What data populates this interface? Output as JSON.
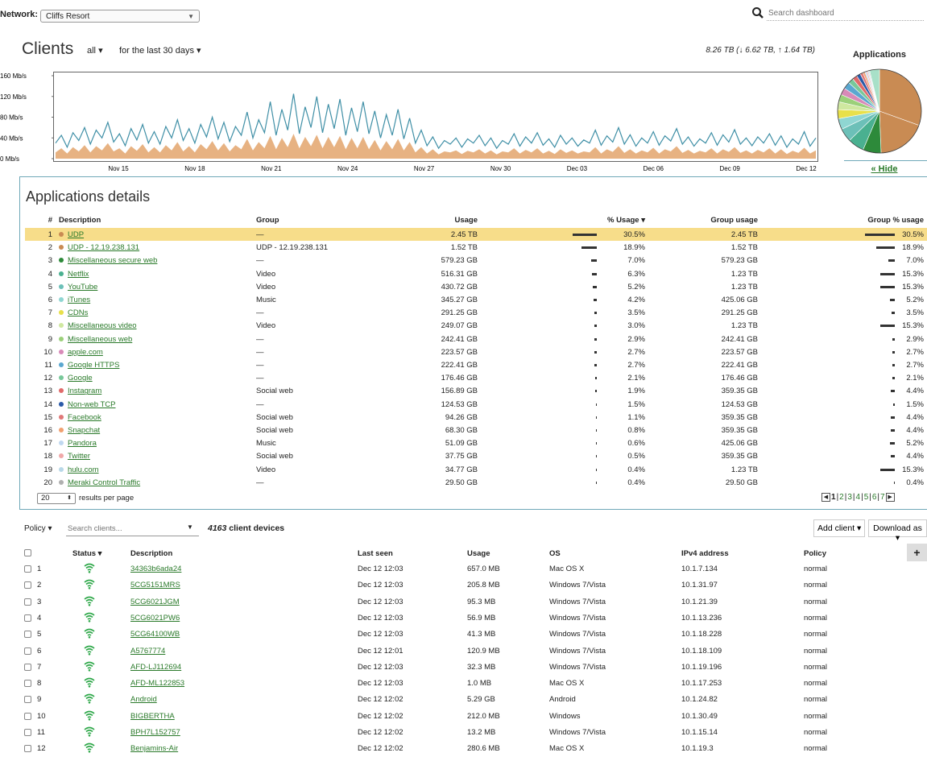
{
  "network": {
    "label": "Network:",
    "value": "Cliffs Resort"
  },
  "search": {
    "placeholder": "Search dashboard"
  },
  "clients": {
    "title": "Clients",
    "filter": "all",
    "period": "for the last 30 days",
    "usage_summary": "8.26 TB (↓ 6.62 TB, ↑ 1.64 TB)"
  },
  "applications_title": "Applications",
  "hide_link": "« Hide",
  "colors": {
    "accent": "#2a7a2a",
    "down_line": "#3f8fa6",
    "up_fill": "#e3a56c",
    "highlight": "#f7dd8a"
  },
  "chart_data": {
    "type": "area",
    "yticks": [
      "160 Mb/s",
      "120 Mb/s",
      "80 Mb/s",
      "40 Mb/s",
      "0 Mb/s"
    ],
    "ylim": [
      0,
      160
    ],
    "xticks": [
      "Nov 15",
      "Nov 18",
      "Nov 21",
      "Nov 24",
      "Nov 27",
      "Nov 30",
      "Dec 03",
      "Dec 06",
      "Dec 09",
      "Dec 12"
    ],
    "series": [
      {
        "values": [
          30,
          45,
          22,
          50,
          35,
          60,
          28,
          55,
          40,
          70,
          32,
          48,
          25,
          58,
          36,
          66,
          30,
          52,
          28,
          62,
          40,
          75,
          35,
          58,
          30,
          66,
          42,
          80,
          38,
          70,
          33,
          62,
          45,
          90,
          40,
          75,
          50,
          110,
          45,
          95,
          55,
          125,
          48,
          100,
          60,
          120,
          50,
          105,
          58,
          115,
          45,
          98,
          52,
          110,
          48,
          92,
          40,
          85,
          45,
          95,
          38,
          78,
          30,
          55,
          25,
          42,
          20,
          35,
          28,
          40,
          22,
          38,
          30,
          45,
          25,
          40,
          20,
          35,
          28,
          48,
          24,
          42,
          30,
          50,
          26,
          38,
          22,
          45,
          28,
          40,
          24,
          36,
          30,
          55,
          26,
          44,
          32,
          60,
          28,
          46,
          24,
          40,
          30,
          52,
          26,
          44,
          34,
          58,
          28,
          42,
          24,
          38,
          30,
          50,
          26,
          46,
          32,
          56,
          28,
          40,
          25,
          42,
          30,
          48,
          26,
          44,
          22,
          38,
          28,
          52,
          24,
          40
        ]
      },
      {
        "values": [
          12,
          20,
          10,
          22,
          14,
          26,
          12,
          24,
          16,
          30,
          14,
          20,
          10,
          24,
          15,
          28,
          12,
          22,
          12,
          26,
          16,
          32,
          14,
          24,
          12,
          28,
          18,
          34,
          16,
          30,
          14,
          26,
          18,
          38,
          16,
          32,
          20,
          44,
          18,
          40,
          22,
          48,
          20,
          42,
          24,
          46,
          20,
          42,
          22,
          44,
          18,
          40,
          20,
          42,
          18,
          36,
          16,
          34,
          18,
          38,
          16,
          32,
          12,
          22,
          10,
          18,
          8,
          14,
          12,
          16,
          9,
          15,
          12,
          18,
          10,
          16,
          8,
          14,
          12,
          20,
          10,
          17,
          12,
          20,
          10,
          15,
          9,
          18,
          11,
          16,
          10,
          14,
          12,
          22,
          10,
          18,
          13,
          24,
          11,
          18,
          10,
          16,
          12,
          21,
          10,
          18,
          14,
          24,
          11,
          17,
          10,
          15,
          12,
          20,
          10,
          18,
          13,
          22,
          11,
          16,
          10,
          17,
          12,
          20,
          10,
          18,
          9,
          15,
          11,
          21,
          10,
          16
        ]
      }
    ]
  },
  "pie_data": {
    "type": "pie",
    "values": [
      30.5,
      18.9,
      7.0,
      6.3,
      5.2,
      4.2,
      3.5,
      3.0,
      2.9,
      2.7,
      2.7,
      2.1,
      1.9,
      1.5,
      1.1,
      0.8,
      0.6,
      0.5,
      0.4,
      0.4,
      3.8
    ],
    "colors": [
      "#c98b53",
      "#c98b53",
      "#2d8a3a",
      "#4ab090",
      "#6cc0b8",
      "#8fd6d2",
      "#e8e04a",
      "#cfe8a0",
      "#9bd07a",
      "#d88ab8",
      "#5aa7d0",
      "#78c89a",
      "#e06a6a",
      "#2a5aa8",
      "#e07878",
      "#f0a070",
      "#c0d8f0",
      "#f0a8a8",
      "#b8d8e8",
      "#d0d0d0",
      "#a8e0c8"
    ]
  },
  "apps": {
    "heading": "Applications details",
    "columns": {
      "num": "#",
      "desc": "Description",
      "group": "Group",
      "usage": "Usage",
      "pct": "% Usage ▾",
      "gusage": "Group usage",
      "gpct": "Group % usage"
    },
    "rows": [
      {
        "n": "1",
        "d": "UDP",
        "g": "—",
        "u": "2.45 TB",
        "p": "30.5%",
        "pv": 30.5,
        "gu": "2.45 TB",
        "gp": "30.5%",
        "gv": 30.5,
        "c": "#c98b53"
      },
      {
        "n": "2",
        "d": "UDP - 12.19.238.131",
        "g": "UDP - 12.19.238.131",
        "u": "1.52 TB",
        "p": "18.9%",
        "pv": 18.9,
        "gu": "1.52 TB",
        "gp": "18.9%",
        "gv": 18.9,
        "c": "#c98b53"
      },
      {
        "n": "3",
        "d": "Miscellaneous secure web",
        "g": "—",
        "u": "579.23 GB",
        "p": "7.0%",
        "pv": 7.0,
        "gu": "579.23 GB",
        "gp": "7.0%",
        "gv": 7.0,
        "c": "#2d8a3a"
      },
      {
        "n": "4",
        "d": "Netflix",
        "g": "Video",
        "u": "516.31 GB",
        "p": "6.3%",
        "pv": 6.3,
        "gu": "1.23 TB",
        "gp": "15.3%",
        "gv": 15.3,
        "c": "#4ab090"
      },
      {
        "n": "5",
        "d": "YouTube",
        "g": "Video",
        "u": "430.72 GB",
        "p": "5.2%",
        "pv": 5.2,
        "gu": "1.23 TB",
        "gp": "15.3%",
        "gv": 15.3,
        "c": "#6cc0b8"
      },
      {
        "n": "6",
        "d": "iTunes",
        "g": "Music",
        "u": "345.27 GB",
        "p": "4.2%",
        "pv": 4.2,
        "gu": "425.06 GB",
        "gp": "5.2%",
        "gv": 5.2,
        "c": "#8fd6d2"
      },
      {
        "n": "7",
        "d": "CDNs",
        "g": "—",
        "u": "291.25 GB",
        "p": "3.5%",
        "pv": 3.5,
        "gu": "291.25 GB",
        "gp": "3.5%",
        "gv": 3.5,
        "c": "#e8e04a"
      },
      {
        "n": "8",
        "d": "Miscellaneous video",
        "g": "Video",
        "u": "249.07 GB",
        "p": "3.0%",
        "pv": 3.0,
        "gu": "1.23 TB",
        "gp": "15.3%",
        "gv": 15.3,
        "c": "#cfe8a0"
      },
      {
        "n": "9",
        "d": "Miscellaneous web",
        "g": "—",
        "u": "242.41 GB",
        "p": "2.9%",
        "pv": 2.9,
        "gu": "242.41 GB",
        "gp": "2.9%",
        "gv": 2.9,
        "c": "#9bd07a"
      },
      {
        "n": "10",
        "d": "apple.com",
        "g": "—",
        "u": "223.57 GB",
        "p": "2.7%",
        "pv": 2.7,
        "gu": "223.57 GB",
        "gp": "2.7%",
        "gv": 2.7,
        "c": "#d88ab8"
      },
      {
        "n": "11",
        "d": "Google HTTPS",
        "g": "—",
        "u": "222.41 GB",
        "p": "2.7%",
        "pv": 2.7,
        "gu": "222.41 GB",
        "gp": "2.7%",
        "gv": 2.7,
        "c": "#5aa7d0"
      },
      {
        "n": "12",
        "d": "Google",
        "g": "—",
        "u": "176.46 GB",
        "p": "2.1%",
        "pv": 2.1,
        "gu": "176.46 GB",
        "gp": "2.1%",
        "gv": 2.1,
        "c": "#78c89a"
      },
      {
        "n": "13",
        "d": "Instagram",
        "g": "Social web",
        "u": "156.89 GB",
        "p": "1.9%",
        "pv": 1.9,
        "gu": "359.35 GB",
        "gp": "4.4%",
        "gv": 4.4,
        "c": "#e06a6a"
      },
      {
        "n": "14",
        "d": "Non-web TCP",
        "g": "—",
        "u": "124.53 GB",
        "p": "1.5%",
        "pv": 1.5,
        "gu": "124.53 GB",
        "gp": "1.5%",
        "gv": 1.5,
        "c": "#2a5aa8"
      },
      {
        "n": "15",
        "d": "Facebook",
        "g": "Social web",
        "u": "94.26 GB",
        "p": "1.1%",
        "pv": 1.1,
        "gu": "359.35 GB",
        "gp": "4.4%",
        "gv": 4.4,
        "c": "#e07878"
      },
      {
        "n": "16",
        "d": "Snapchat",
        "g": "Social web",
        "u": "68.30 GB",
        "p": "0.8%",
        "pv": 0.8,
        "gu": "359.35 GB",
        "gp": "4.4%",
        "gv": 4.4,
        "c": "#f0a070"
      },
      {
        "n": "17",
        "d": "Pandora",
        "g": "Music",
        "u": "51.09 GB",
        "p": "0.6%",
        "pv": 0.6,
        "gu": "425.06 GB",
        "gp": "5.2%",
        "gv": 5.2,
        "c": "#c0d8f0"
      },
      {
        "n": "18",
        "d": "Twitter",
        "g": "Social web",
        "u": "37.75 GB",
        "p": "0.5%",
        "pv": 0.5,
        "gu": "359.35 GB",
        "gp": "4.4%",
        "gv": 4.4,
        "c": "#f0a8a8"
      },
      {
        "n": "19",
        "d": "hulu.com",
        "g": "Video",
        "u": "34.77 GB",
        "p": "0.4%",
        "pv": 0.4,
        "gu": "1.23 TB",
        "gp": "15.3%",
        "gv": 15.3,
        "c": "#b8d8e8"
      },
      {
        "n": "20",
        "d": "Meraki Control Traffic",
        "g": "—",
        "u": "29.50 GB",
        "p": "0.4%",
        "pv": 0.4,
        "gu": "29.50 GB",
        "gp": "0.4%",
        "gv": 0.4,
        "c": "#b0b0b0"
      }
    ],
    "per_page": "20",
    "per_page_label": "results per page",
    "pages": [
      "1",
      "2",
      "3",
      "4",
      "5",
      "6",
      "7"
    ],
    "current_page": "1"
  },
  "client_list": {
    "policy_label": "Policy",
    "search_placeholder": "Search clients...",
    "count": "4163",
    "count_label": " client devices",
    "add_client": "Add client",
    "download": "Download as",
    "add_column": "+",
    "columns": {
      "status": "Status ▾",
      "desc": "Description",
      "last_seen": "Last seen",
      "usage": "Usage",
      "os": "OS",
      "ip": "IPv4 address",
      "policy": "Policy"
    },
    "rows": [
      {
        "n": "1",
        "d": "34363b6ada24",
        "s": "Dec 12 12:03",
        "u": "657.0 MB",
        "os": "Mac OS X",
        "ip": "10.1.7.134",
        "p": "normal"
      },
      {
        "n": "2",
        "d": "5CG5151MRS",
        "s": "Dec 12 12:03",
        "u": "205.8 MB",
        "os": "Windows 7/Vista",
        "ip": "10.1.31.97",
        "p": "normal"
      },
      {
        "n": "3",
        "d": "5CG6021JGM",
        "s": "Dec 12 12:03",
        "u": "95.3 MB",
        "os": "Windows 7/Vista",
        "ip": "10.1.21.39",
        "p": "normal"
      },
      {
        "n": "4",
        "d": "5CG6021PW6",
        "s": "Dec 12 12:03",
        "u": "56.9 MB",
        "os": "Windows 7/Vista",
        "ip": "10.1.13.236",
        "p": "normal"
      },
      {
        "n": "5",
        "d": "5CG64100WB",
        "s": "Dec 12 12:03",
        "u": "41.3 MB",
        "os": "Windows 7/Vista",
        "ip": "10.1.18.228",
        "p": "normal"
      },
      {
        "n": "6",
        "d": "A5767774",
        "s": "Dec 12 12:01",
        "u": "120.9 MB",
        "os": "Windows 7/Vista",
        "ip": "10.1.18.109",
        "p": "normal"
      },
      {
        "n": "7",
        "d": "AFD-LJ112694",
        "s": "Dec 12 12:03",
        "u": "32.3 MB",
        "os": "Windows 7/Vista",
        "ip": "10.1.19.196",
        "p": "normal"
      },
      {
        "n": "8",
        "d": "AFD-ML122853",
        "s": "Dec 12 12:03",
        "u": "1.0 MB",
        "os": "Mac OS X",
        "ip": "10.1.17.253",
        "p": "normal"
      },
      {
        "n": "9",
        "d": "Android",
        "s": "Dec 12 12:02",
        "u": "5.29 GB",
        "os": "Android",
        "ip": "10.1.24.82",
        "p": "normal"
      },
      {
        "n": "10",
        "d": "BIGBERTHA",
        "s": "Dec 12 12:02",
        "u": "212.0 MB",
        "os": "Windows",
        "ip": "10.1.30.49",
        "p": "normal"
      },
      {
        "n": "11",
        "d": "BPH7L152757",
        "s": "Dec 12 12:02",
        "u": "13.2 MB",
        "os": "Windows 7/Vista",
        "ip": "10.1.15.14",
        "p": "normal"
      },
      {
        "n": "12",
        "d": "Benjamins-Air",
        "s": "Dec 12 12:02",
        "u": "280.6 MB",
        "os": "Mac OS X",
        "ip": "10.1.19.3",
        "p": "normal"
      }
    ]
  }
}
